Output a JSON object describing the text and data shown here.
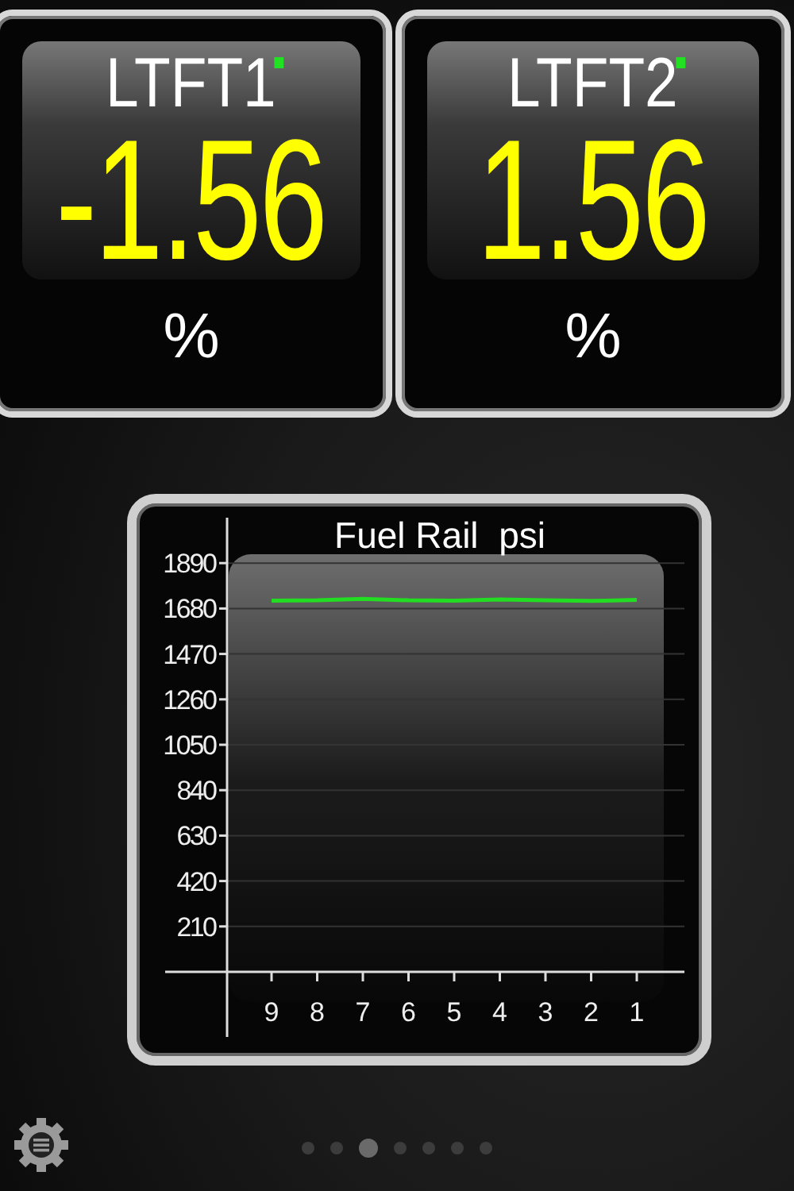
{
  "gauges": [
    {
      "title": "LTFT1",
      "indicator_on": true,
      "value": "-1.56",
      "unit": "%"
    },
    {
      "title": "LTFT2",
      "indicator_on": true,
      "value": "1.56",
      "unit": "%"
    }
  ],
  "graph": {
    "chart_data": {
      "type": "line",
      "title": "Fuel Rail  psi",
      "categories": [
        "9",
        "8",
        "7",
        "6",
        "5",
        "4",
        "3",
        "2",
        "1"
      ],
      "grid": true,
      "series": [
        {
          "color": "#22dd22",
          "values": [
            1716,
            1718,
            1725,
            1718,
            1716,
            1722,
            1718,
            1715,
            1720
          ]
        }
      ],
      "ylim": [
        0,
        2100
      ],
      "yticks": [
        210,
        420,
        630,
        840,
        1050,
        1260,
        1470,
        1680,
        1890
      ]
    }
  },
  "pages": [
    {
      "selected": false
    },
    {
      "selected": false
    },
    {
      "selected": true
    },
    {
      "selected": false
    },
    {
      "selected": false
    },
    {
      "selected": false
    },
    {
      "selected": false
    }
  ]
}
